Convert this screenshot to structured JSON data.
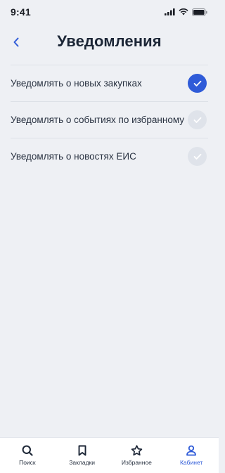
{
  "status_bar": {
    "time": "9:41"
  },
  "header": {
    "title": "Уведомления"
  },
  "settings": [
    {
      "label": "Уведомлять о новых закупках",
      "checked": true
    },
    {
      "label": "Уведомлять о событиях по избранному",
      "checked": false
    },
    {
      "label": "Уведомлять о новостях ЕИС",
      "checked": false
    }
  ],
  "tab_bar": {
    "tabs": [
      {
        "label": "Поиск",
        "icon": "search-icon",
        "active": false
      },
      {
        "label": "Закладки",
        "icon": "bookmark-icon",
        "active": false
      },
      {
        "label": "Избранное",
        "icon": "star-icon",
        "active": false
      },
      {
        "label": "Кабинет",
        "icon": "user-icon",
        "active": true
      }
    ]
  },
  "colors": {
    "accent": "#2f5bd8",
    "background": "#eef0f4",
    "unchecked": "#dfe3ea"
  }
}
